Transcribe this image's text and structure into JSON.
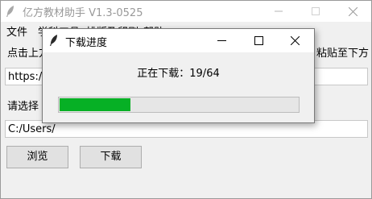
{
  "main_window": {
    "title": "亿方教材助手 V1.3-0525",
    "menu": [
      "文件",
      "学科工具",
      "排版及印刷",
      "帮助"
    ],
    "instruction_left": "点击上方",
    "instruction_right": "粘贴至下方",
    "url_value": "https://",
    "choose_label": "请选择",
    "path_value": "C:/Users/",
    "browse_label": "浏览",
    "download_label": "下载"
  },
  "dialog": {
    "title": "下载进度",
    "status": "正在下载：19/64",
    "progress_current": 19,
    "progress_total": 64,
    "progress_color": "#06b025"
  }
}
